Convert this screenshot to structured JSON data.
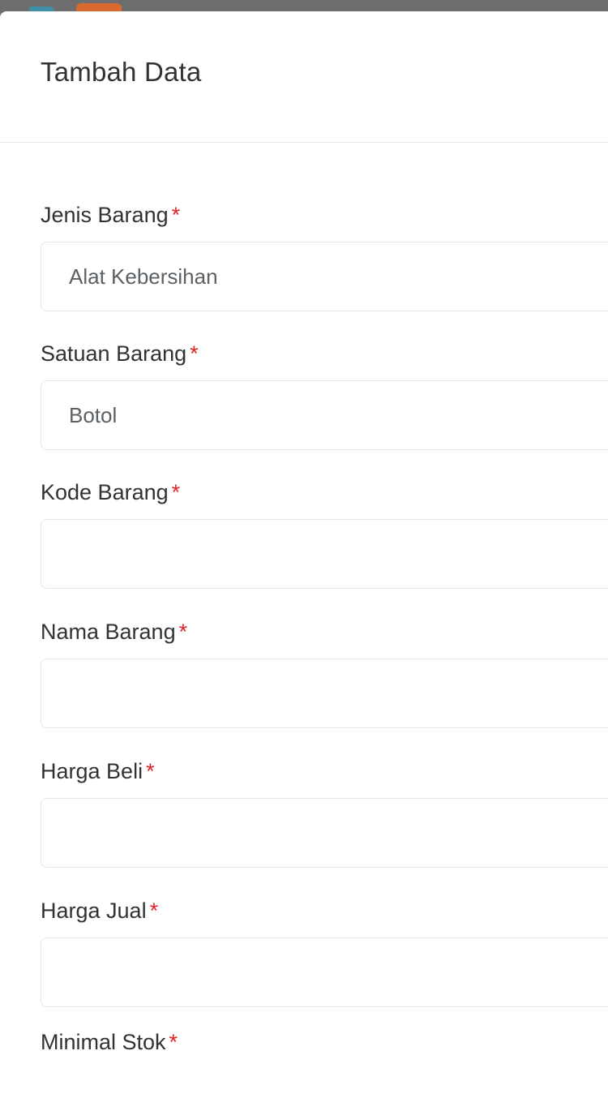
{
  "modal": {
    "title": "Tambah Data"
  },
  "form": {
    "jenis_barang": {
      "label": "Jenis Barang",
      "required_mark": "*",
      "value": "Alat Kebersihan"
    },
    "satuan_barang": {
      "label": "Satuan Barang",
      "required_mark": "*",
      "value": "Botol"
    },
    "kode_barang": {
      "label": "Kode Barang",
      "required_mark": "*",
      "value": ""
    },
    "nama_barang": {
      "label": "Nama Barang",
      "required_mark": "*",
      "value": ""
    },
    "harga_beli": {
      "label": "Harga Beli",
      "required_mark": "*",
      "value": ""
    },
    "harga_jual": {
      "label": "Harga Jual",
      "required_mark": "*",
      "value": ""
    },
    "minimal_stok": {
      "label": "Minimal Stok",
      "required_mark": "*"
    }
  },
  "colors": {
    "required": "#e02424",
    "text": "#2f3336",
    "border": "#e4e7ea"
  }
}
